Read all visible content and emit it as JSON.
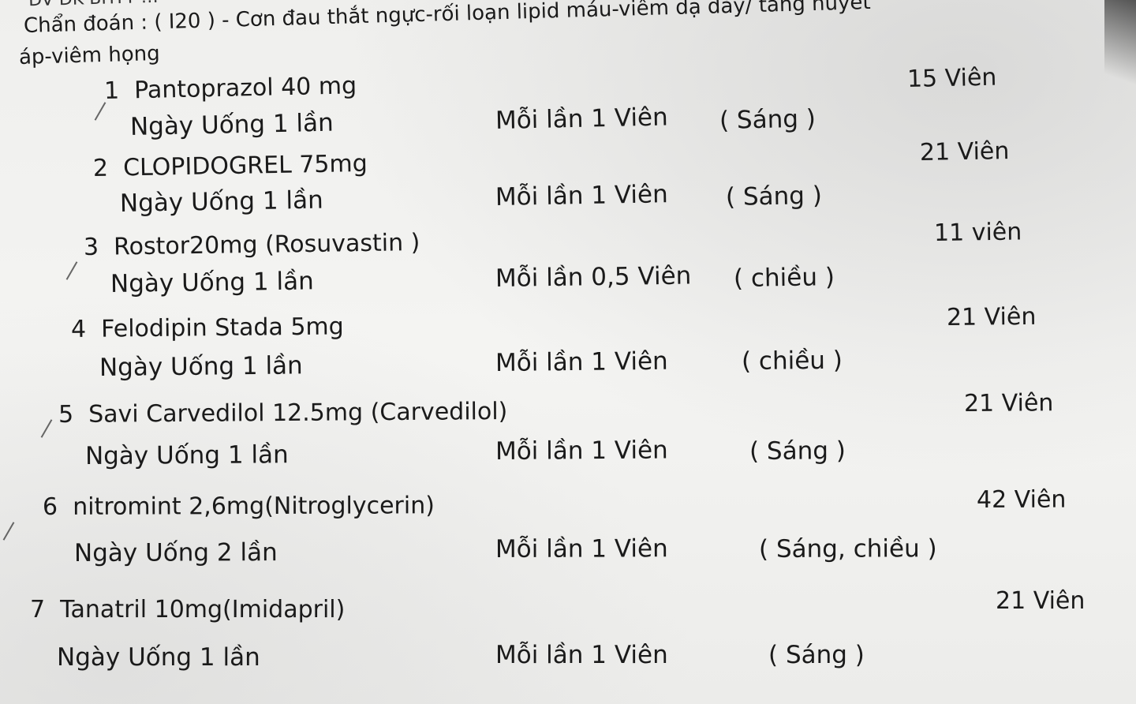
{
  "header_cut": "ĐV ĐK BHYT …",
  "diagnosis": {
    "line1": "Chẩn đoán :  ( I20 ) - Cơn đau thắt ngực-rối loạn lipid máu-viêm dạ dày/ tăng huyết",
    "line2": "áp-viêm họng"
  },
  "prescriptions": [
    {
      "index": "1",
      "name": "Pantoprazol 40 mg",
      "quantity": "15  Viên",
      "usage": "Ngày Uống 1 lần",
      "per_dose": "Mỗi lần 1 Viên",
      "time": "( Sáng )"
    },
    {
      "index": "2",
      "name": "CLOPIDOGREL 75mg",
      "quantity": "21  Viên",
      "usage": "Ngày Uống 1 lần",
      "per_dose": "Mỗi lần 1 Viên",
      "time": "( Sáng )"
    },
    {
      "index": "3",
      "name": "Rostor20mg (Rosuvastin )",
      "quantity": "11  viên",
      "usage": "Ngày Uống 1 lần",
      "per_dose": "Mỗi lần 0,5 Viên",
      "time": "( chiều )"
    },
    {
      "index": "4",
      "name": "Felodipin Stada 5mg",
      "quantity": "21  Viên",
      "usage": "Ngày Uống 1 lần",
      "per_dose": "Mỗi lần 1 Viên",
      "time": "( chiều )"
    },
    {
      "index": "5",
      "name": "Savi Carvedilol 12.5mg (Carvedilol)",
      "quantity": "21  Viên",
      "usage": "Ngày Uống 1 lần",
      "per_dose": "Mỗi lần 1 Viên",
      "time": "( Sáng )"
    },
    {
      "index": "6",
      "name": "nitromint 2,6mg(Nitroglycerin)",
      "quantity": "42  Viên",
      "usage": "Ngày Uống 2 lần",
      "per_dose": "Mỗi lần 1 Viên",
      "time": "( Sáng, chiều )"
    },
    {
      "index": "7",
      "name": "Tanatril 10mg(Imidapril)",
      "quantity": "21  Viên",
      "usage": "Ngày Uống 1 lần",
      "per_dose": "Mỗi lần 1 Viên",
      "time": "( Sáng )"
    }
  ]
}
